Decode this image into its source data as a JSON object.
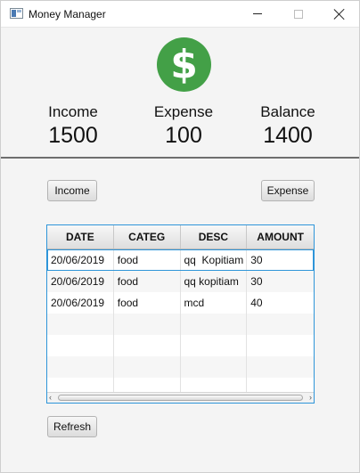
{
  "window": {
    "title": "Money Manager"
  },
  "summary": {
    "income_label": "Income",
    "income_value": "1500",
    "expense_label": "Expense",
    "expense_value": "100",
    "balance_label": "Balance",
    "balance_value": "1400"
  },
  "buttons": {
    "income": "Income",
    "expense": "Expense",
    "refresh": "Refresh"
  },
  "table": {
    "columns": [
      "DATE",
      "CATEG",
      "DESC",
      "AMOUNT"
    ],
    "rows": [
      [
        "20/06/2019",
        "food",
        "qq  Kopitiam",
        "30"
      ],
      [
        "20/06/2019",
        "food",
        "qq kopitiam",
        "30"
      ],
      [
        "20/06/2019",
        "food",
        "mcd",
        "40"
      ]
    ]
  },
  "colors": {
    "dollar_icon": "#43a047",
    "table_focus": "#2e95d9"
  },
  "icons": {
    "app": "app-window-icon",
    "currency": "dollar-icon"
  }
}
